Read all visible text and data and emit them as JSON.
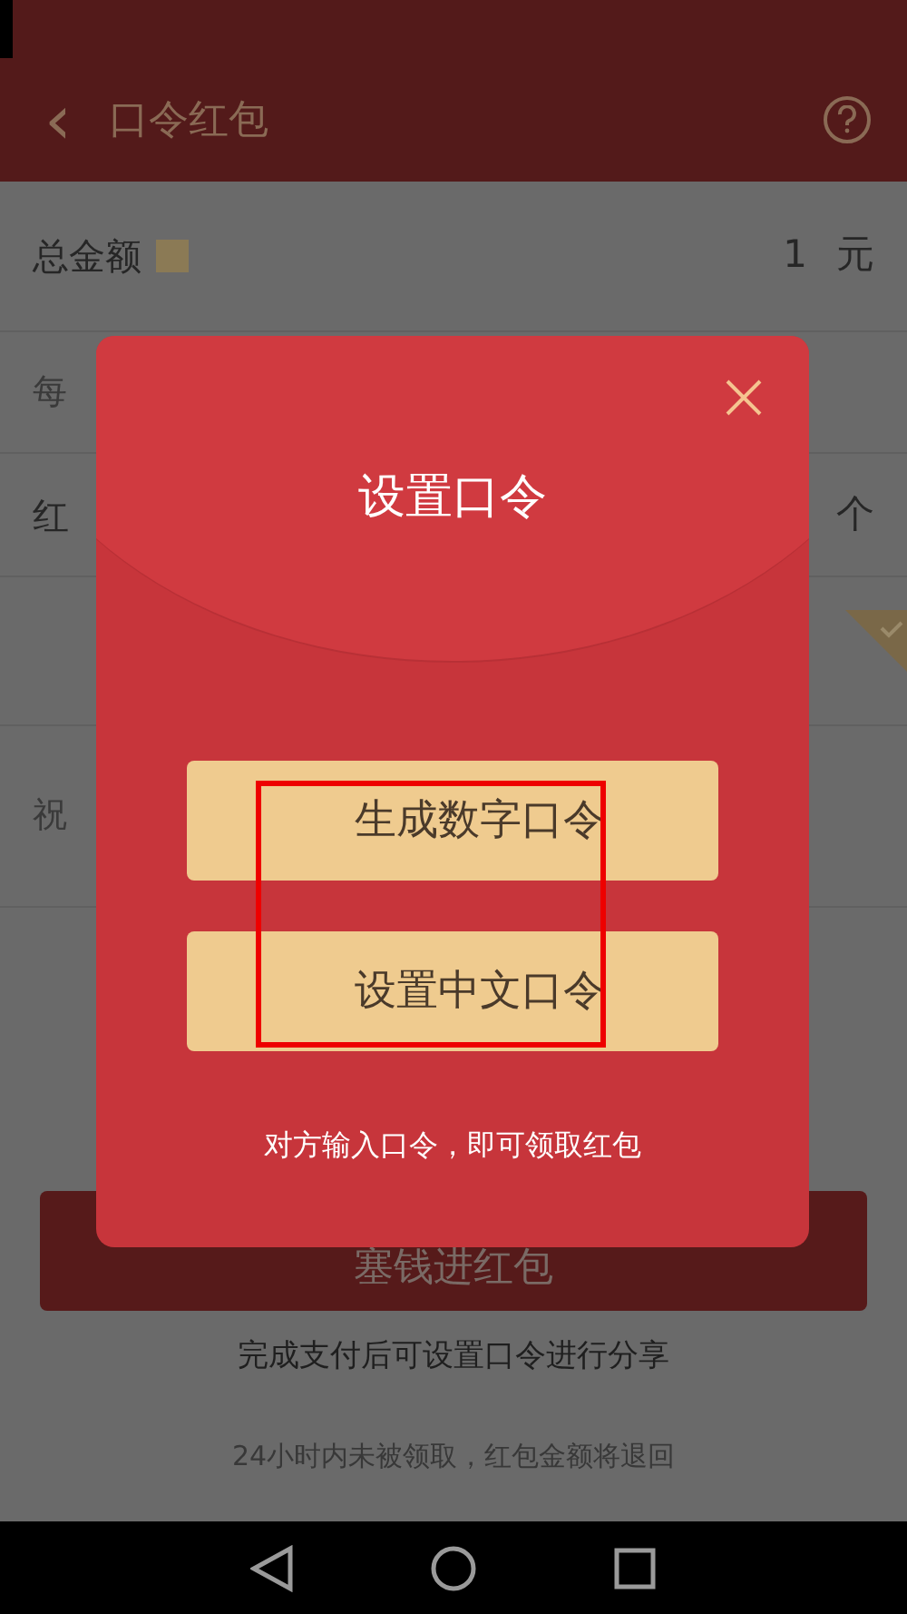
{
  "header": {
    "back": "‹",
    "title": "口令红包"
  },
  "form": {
    "rows": [
      {
        "kind": "amount",
        "label": "总金额",
        "value": "1",
        "unit": "元"
      },
      {
        "kind": "hint",
        "placeholder": "每"
      },
      {
        "kind": "count",
        "label": "红",
        "unit": "个"
      },
      {
        "kind": "option",
        "checked": true
      },
      {
        "kind": "greeting",
        "placeholder": "祝"
      }
    ]
  },
  "submit_button": "塞钱进红包",
  "share_note": "完成支付后可设置口令进行分享",
  "refund_note": "24小时内未被领取，红包金额将退回",
  "dialog": {
    "title": "设置口令",
    "buttons": [
      {
        "label": "生成数字口令"
      },
      {
        "label": "设置中文口令"
      }
    ],
    "note": "对方输入口令，即可领取红包",
    "highlighted": true
  }
}
